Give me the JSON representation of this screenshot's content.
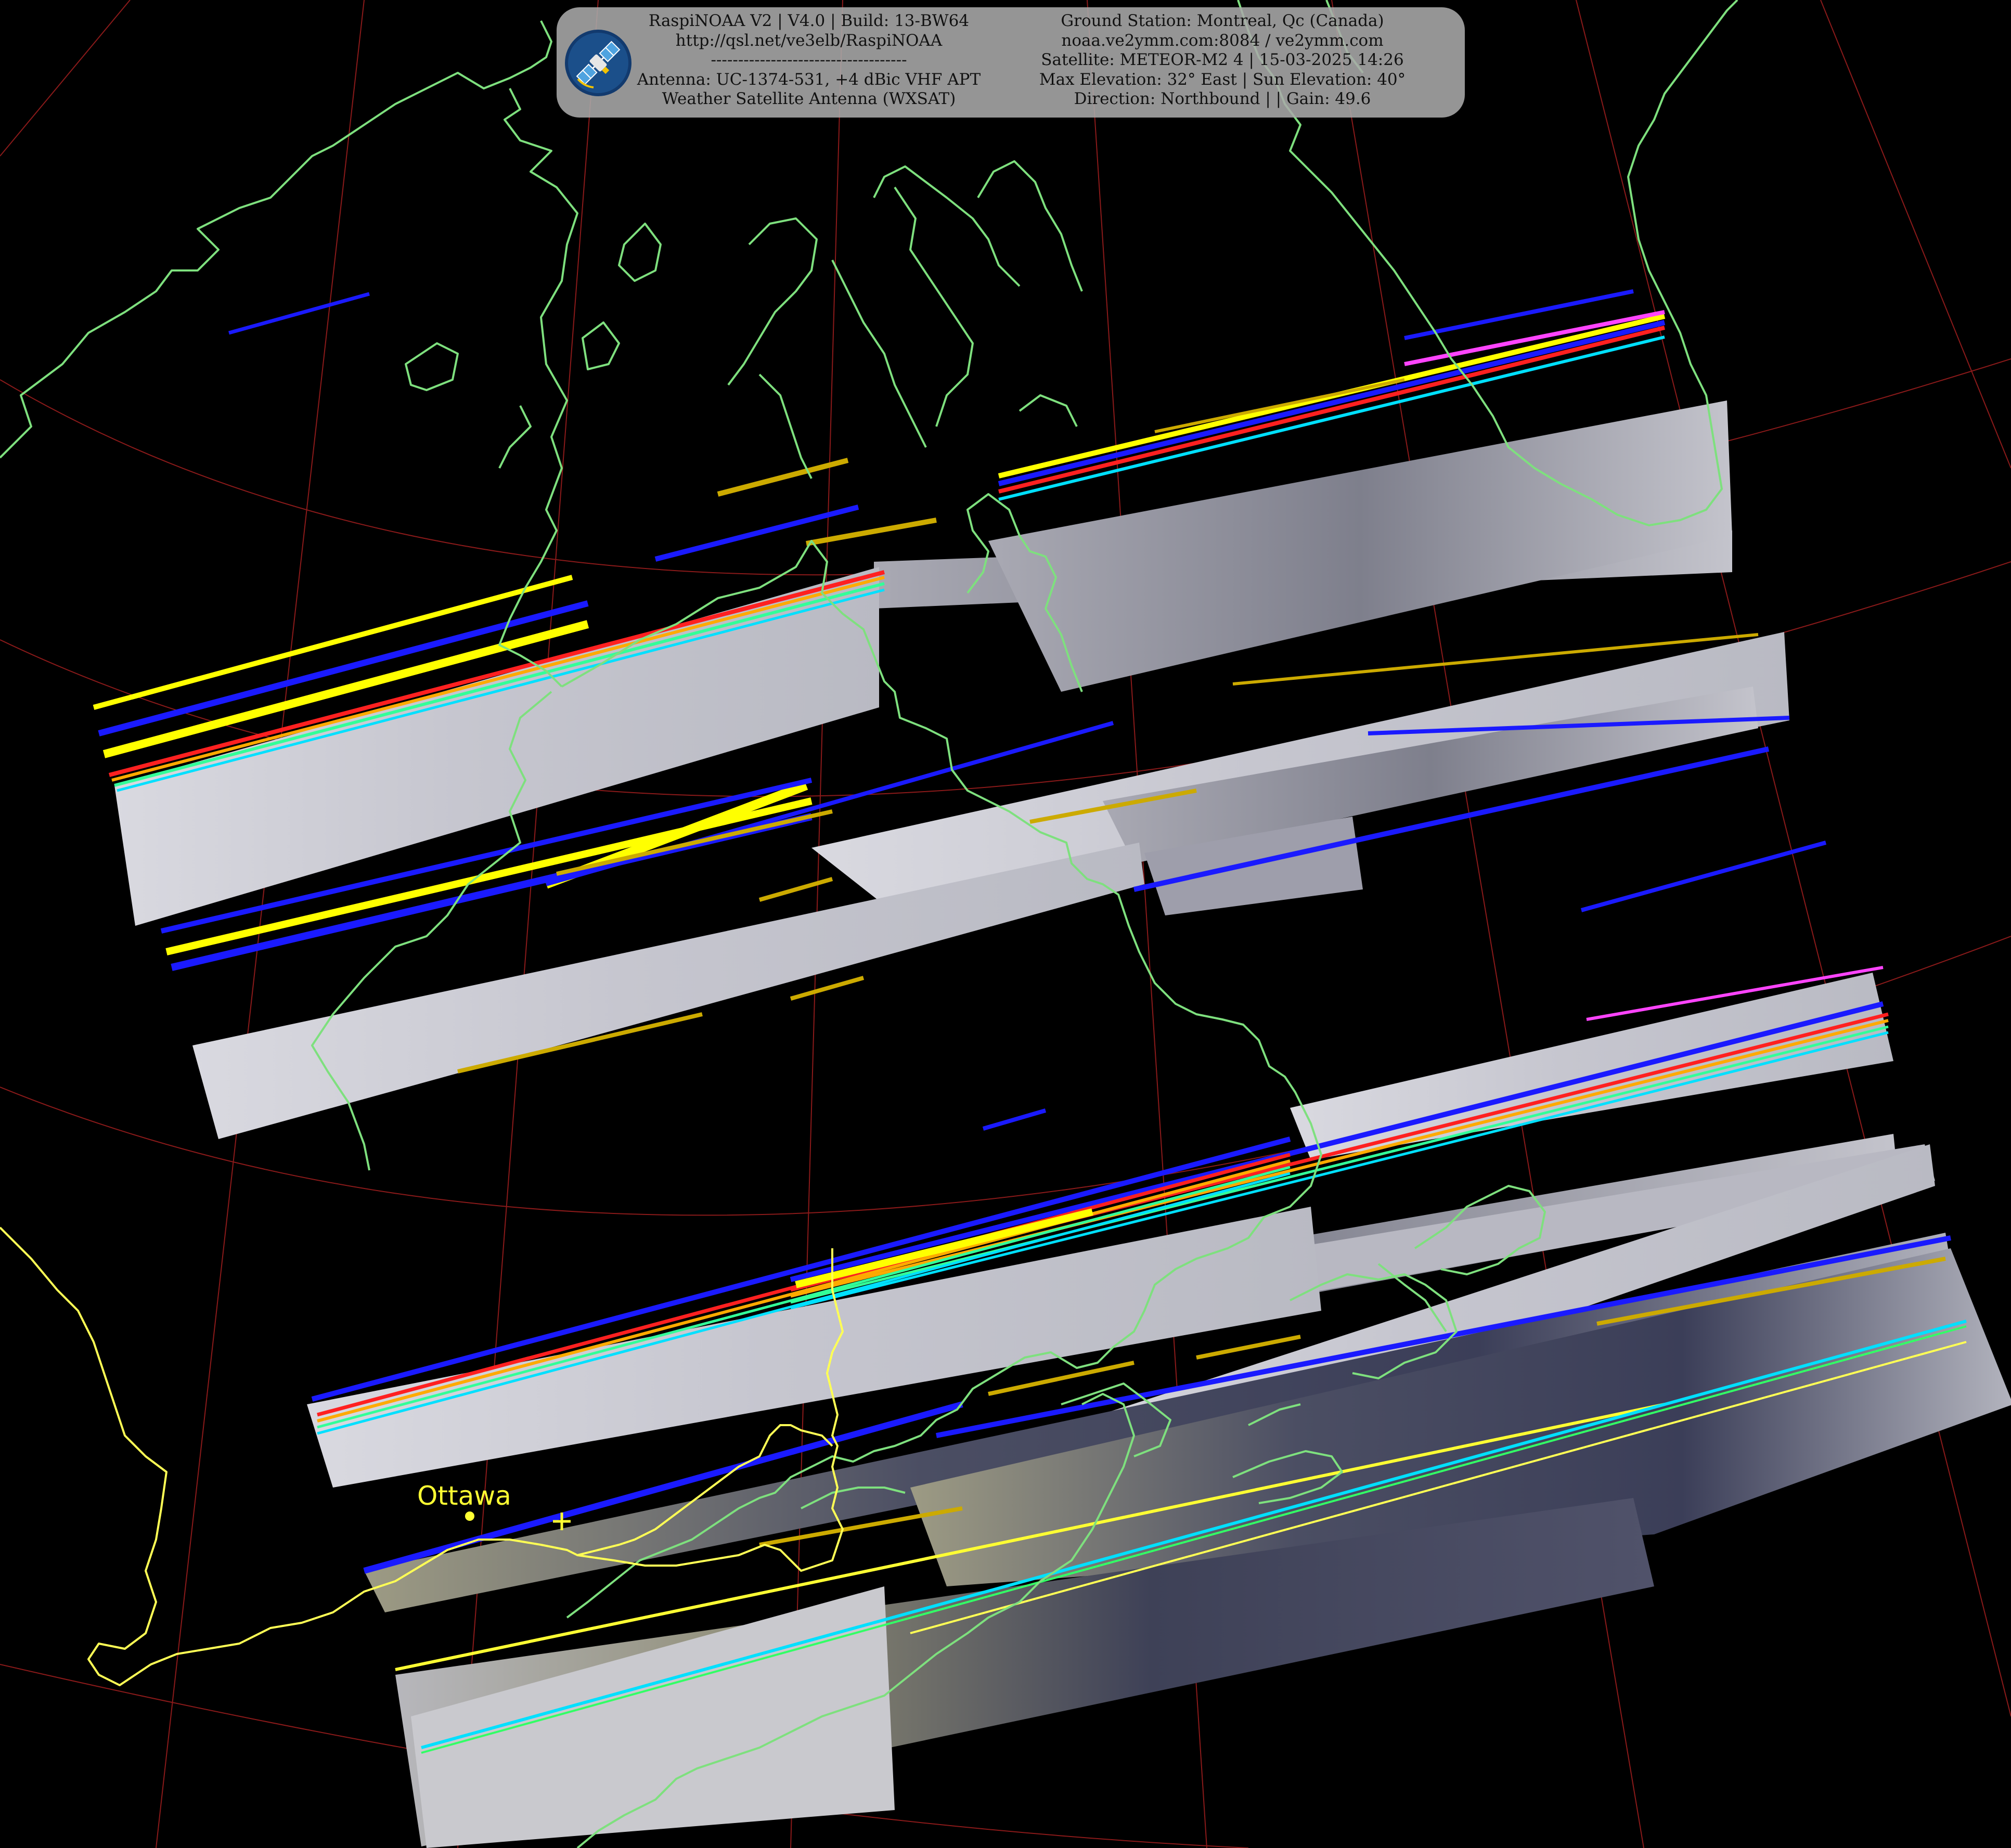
{
  "info_panel": {
    "left_lines": [
      "RaspiNOAA V2 | V4.0 | Build: 13-BW64",
      "http://qsl.net/ve3elb/RaspiNOAA",
      "------------------------------------",
      "Antenna: UC-1374-531, +4 dBic VHF APT",
      "Weather Satellite Antenna (WXSAT)"
    ],
    "right_lines": [
      "Ground Station: Montreal, Qc (Canada)",
      "noaa.ve2ymm.com:8084 / ve2ymm.com",
      "Satellite: METEOR-M2 4 | 15-03-2025 14:26",
      "Max Elevation: 32° East | Sun Elevation: 40°",
      "Direction: Northbound | | Gain: 49.6"
    ],
    "logo_icon": "satellite-icon"
  },
  "map": {
    "city_labels": [
      "Ottawa"
    ],
    "ground_station_marker": "crosshair-icon",
    "colors": {
      "coastline": "#7ee07e",
      "border": "#ffff55",
      "graticule": "#8b1a1a",
      "background": "#000000",
      "panel": "#aaaaaa"
    }
  }
}
